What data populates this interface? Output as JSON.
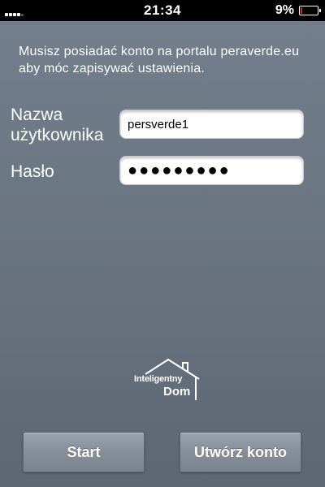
{
  "status_bar": {
    "time": "21:34",
    "battery_percent": "9%",
    "battery_level": 0.09,
    "signal_bars_active": 4,
    "signal_bars_total": 5
  },
  "info": {
    "text": "Musisz posiadać konto na portalu peraverde.eu aby móc zapisywać ustawienia."
  },
  "form": {
    "username_label": "Nazwa użytkownika",
    "username_value": "persverde1",
    "password_label": "Hasło",
    "password_value": "●●●●●●●●●"
  },
  "logo": {
    "line1": "Inteligentny",
    "line2": "Dom"
  },
  "buttons": {
    "start_label": "Start",
    "create_account_label": "Utwórz konto"
  },
  "colors": {
    "background_top": "#737e8c",
    "background_bottom": "#5d6774",
    "battery_low": "#e02020"
  }
}
